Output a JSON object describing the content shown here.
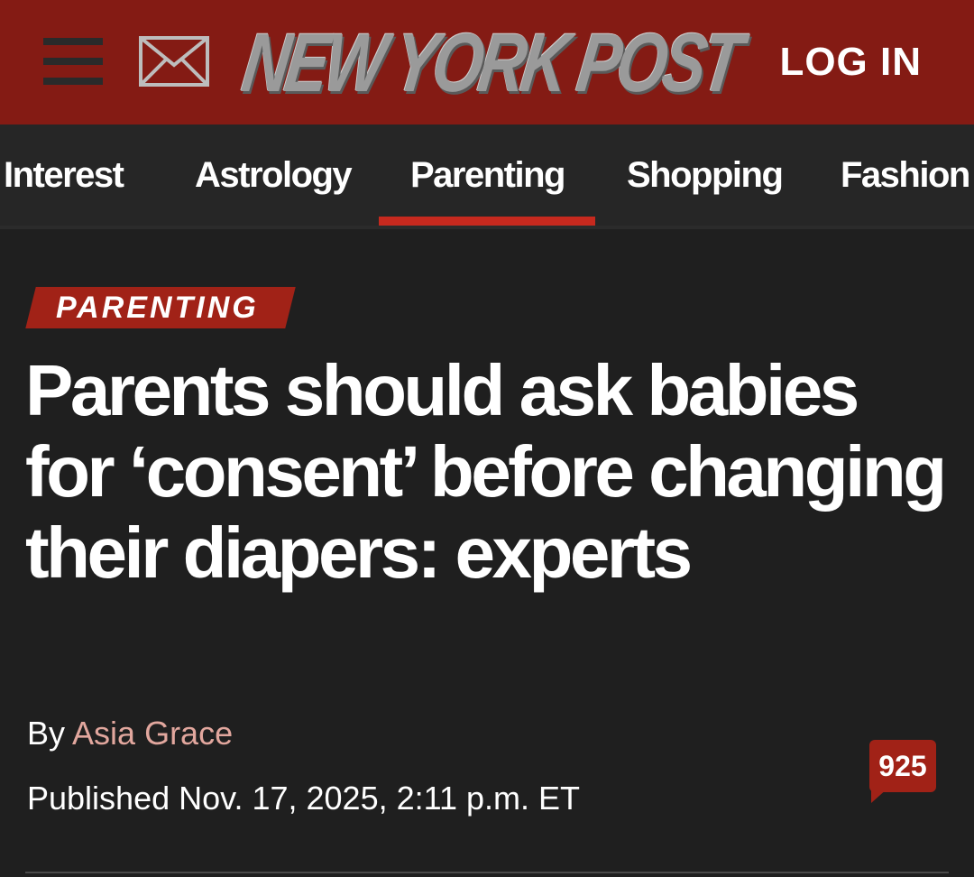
{
  "header": {
    "brand": "NEW YORK POST",
    "login_label": "LOG IN",
    "menu_icon": "hamburger-menu-icon",
    "mail_icon": "envelope-icon",
    "background_color": "#841b14"
  },
  "nav": {
    "items": [
      {
        "label": "Interest"
      },
      {
        "label": "Astrology"
      },
      {
        "label": "Parenting",
        "active": true
      },
      {
        "label": "Shopping"
      },
      {
        "label": "Fashion"
      }
    ],
    "active_color": "#c6291e"
  },
  "article": {
    "category": "PARENTING",
    "headline": "Parents should ask babies for ‘consent’ before changing their diapers: experts",
    "byline_prefix": "By",
    "author": "Asia Grace",
    "published": "Published Nov. 17, 2025, 2:11 p.m. ET",
    "comment_count": "925",
    "comment_icon": "speech-bubble-icon",
    "accent_color": "#a12217",
    "author_color": "#e2a79e"
  }
}
